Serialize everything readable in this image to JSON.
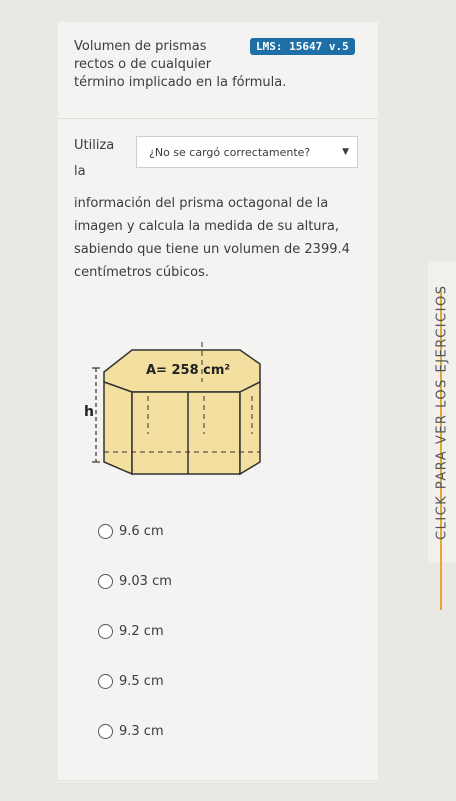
{
  "header": {
    "line1": "Volumen de prismas",
    "line2": "rectos o de cualquier",
    "line3": "término implicado en la fórmula.",
    "badge": "LMS: 15647 v.5"
  },
  "prompt": {
    "utiliza": "Utiliza",
    "la": "la",
    "dropdown_label": "¿No se cargó correctamente?",
    "text": "información del prisma octagonal de la imagen y calcula la medida de su altura, sabiendo que tiene un volumen de 2399.4 centímetros cúbicos."
  },
  "figure": {
    "area_label": "A= 258 cm²",
    "height_label": "h"
  },
  "options": [
    {
      "label": "9.6 cm"
    },
    {
      "label": "9.03 cm"
    },
    {
      "label": "9.2 cm"
    },
    {
      "label": "9.5 cm"
    },
    {
      "label": "9.3 cm"
    }
  ],
  "side_tab": {
    "label": "CLICK PARA VER LOS EJERCICIOS"
  },
  "colors": {
    "accent": "#1d6fa5",
    "side_line": "#e3a833",
    "prism_face": "#f3dfa0"
  }
}
